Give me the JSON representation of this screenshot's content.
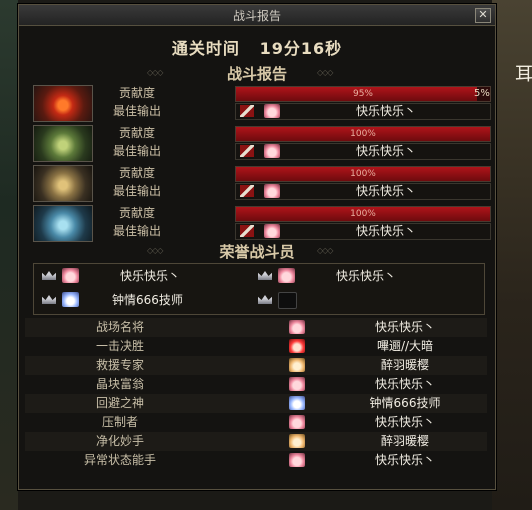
{
  "window": {
    "title": "战斗报告"
  },
  "summary": {
    "clear_time_label": "通关时间",
    "clear_time_value": "19分16秒"
  },
  "section_titles": {
    "battle_report": "战斗报告",
    "honor": "荣誉战斗员"
  },
  "deco": "◇◇◇",
  "battle_report": {
    "contribution_label": "贡献度",
    "best_output_label": "最佳输出",
    "rows": [
      {
        "contribution": "95%",
        "contribution_value": 95,
        "overflow_label": "5%",
        "best_output_name": "快乐快乐丶",
        "portrait_icon": "boss-flame-icon",
        "avatar_color": "pink"
      },
      {
        "contribution": "100%",
        "contribution_value": 100,
        "overflow_label": "",
        "best_output_name": "快乐快乐丶",
        "portrait_icon": "boss-green-icon",
        "avatar_color": "pink"
      },
      {
        "contribution": "100%",
        "contribution_value": 100,
        "overflow_label": "",
        "best_output_name": "快乐快乐丶",
        "portrait_icon": "boss-gold-icon",
        "avatar_color": "pink"
      },
      {
        "contribution": "100%",
        "contribution_value": 100,
        "overflow_label": "",
        "best_output_name": "快乐快乐丶",
        "portrait_icon": "boss-ice-icon",
        "avatar_color": "pink"
      }
    ]
  },
  "honor_players": [
    {
      "name": "快乐快乐丶",
      "avatar_color": "pink"
    },
    {
      "name": "快乐快乐丶",
      "avatar_color": "pink"
    },
    {
      "name": "钟情666技师",
      "avatar_color": "blue"
    },
    {
      "name": "",
      "avatar_color": "empty"
    }
  ],
  "stats": [
    {
      "title": "战场名将",
      "name": "快乐快乐丶",
      "avatar_color": "pink"
    },
    {
      "title": "一击决胜",
      "name": "嗶逦//大暗",
      "avatar_color": "red"
    },
    {
      "title": "救援专家",
      "name": "醉羽暖樱",
      "avatar_color": "gold"
    },
    {
      "title": "晶块富翁",
      "name": "快乐快乐丶",
      "avatar_color": "pink"
    },
    {
      "title": "回避之神",
      "name": "钟情666技师",
      "avatar_color": "blue"
    },
    {
      "title": "压制者",
      "name": "快乐快乐丶",
      "avatar_color": "pink"
    },
    {
      "title": "净化妙手",
      "name": "醉羽暖樱",
      "avatar_color": "gold"
    },
    {
      "title": "异常状态能手",
      "name": "快乐快乐丶",
      "avatar_color": "pink"
    }
  ],
  "background": {
    "edge_char": "耳"
  },
  "colors": {
    "bar_fill": "#b0141a",
    "window_bg": "#141311",
    "gold_text": "#d8c9a8"
  }
}
